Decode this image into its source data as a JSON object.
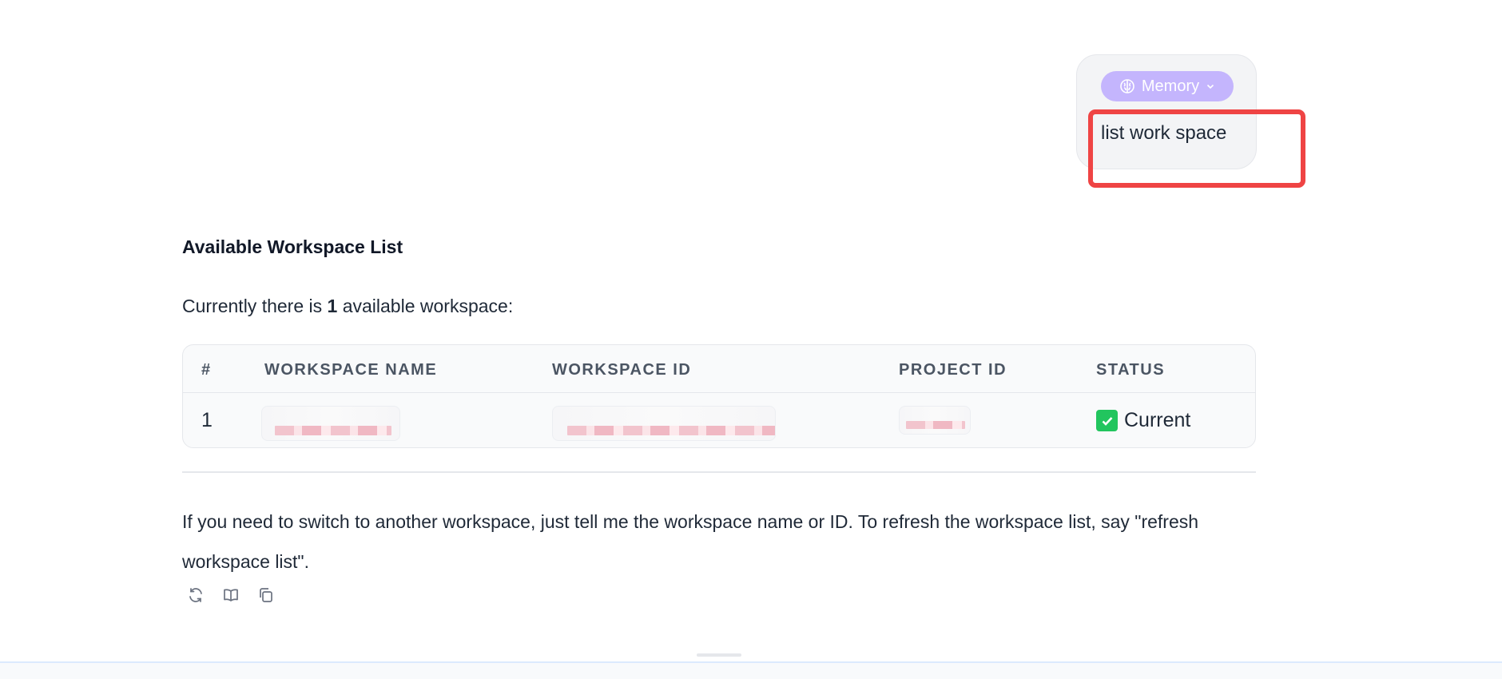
{
  "user_message": {
    "memory_label": "Memory",
    "text": "list work space"
  },
  "assistant": {
    "heading": "Available Workspace List",
    "intro_prefix": "Currently there is ",
    "intro_count": "1",
    "intro_suffix": " available workspace:",
    "table": {
      "headers": [
        "#",
        "WORKSPACE NAME",
        "WORKSPACE ID",
        "PROJECT ID",
        "STATUS"
      ],
      "rows": [
        {
          "index": "1",
          "status": "Current"
        }
      ]
    },
    "closing": "If you need to switch to another workspace, just tell me the workspace name or ID. To refresh the workspace list, say \"refresh workspace list\"."
  },
  "colors": {
    "memory_pill": "#c4b5fd",
    "highlight": "#ef4444",
    "status_check": "#22c55e"
  },
  "icons": [
    "brain-icon",
    "chevron-down-icon",
    "check-icon",
    "refresh-icon",
    "book-icon",
    "copy-icon"
  ]
}
